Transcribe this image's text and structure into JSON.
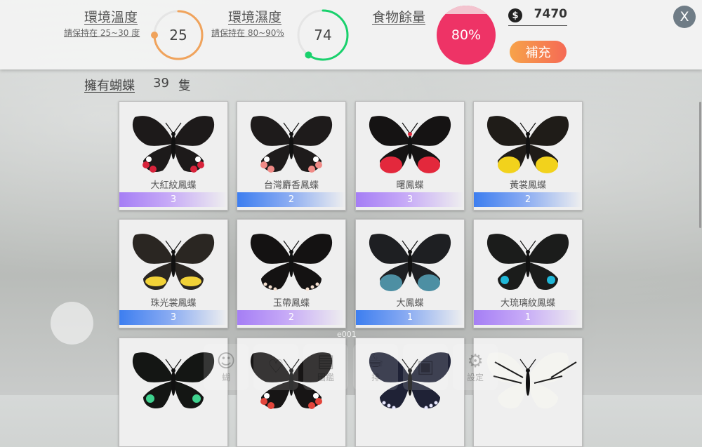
{
  "temperature": {
    "title": "環境溫度",
    "note": "請保持在 25~30 度",
    "value": "25",
    "level": 0.75,
    "color": "#f0a35c"
  },
  "humidity": {
    "title": "環境濕度",
    "note": "請保持在 80~90%",
    "value": "74",
    "level": 0.6,
    "color": "#18d16c"
  },
  "food": {
    "title": "食物餘量",
    "value": "80%",
    "color": "#ee3366"
  },
  "coins": {
    "symbol": "$",
    "amount": "7470"
  },
  "refill_label": "補充",
  "close_label": "X",
  "owned": {
    "label": "擁有蝴蝶",
    "count": "39",
    "unit": "隻"
  },
  "page_id": "e001",
  "butterflies": [
    {
      "name": "大紅紋鳳蝶",
      "count": "3",
      "bar": "purple",
      "icon": "red-spotted-swallowtail"
    },
    {
      "name": "台灣麝香鳳蝶",
      "count": "2",
      "bar": "blue",
      "icon": "pink-spotted-swallowtail"
    },
    {
      "name": "曙鳳蝶",
      "count": "3",
      "bar": "purple",
      "icon": "red-hindwing-swallowtail"
    },
    {
      "name": "黃裳鳳蝶",
      "count": "2",
      "bar": "blue",
      "icon": "yellow-birdwing"
    },
    {
      "name": "珠光裳鳳蝶",
      "count": "3",
      "bar": "blue",
      "icon": "golden-birdwing"
    },
    {
      "name": "玉帶鳳蝶",
      "count": "2",
      "bar": "purple",
      "icon": "white-banded-swallowtail"
    },
    {
      "name": "大鳳蝶",
      "count": "1",
      "bar": "blue",
      "icon": "blue-hindwing-swallowtail"
    },
    {
      "name": "大琉璃紋鳳蝶",
      "count": "1",
      "bar": "purple",
      "icon": "cyan-spotted-swallowtail"
    },
    {
      "name": "",
      "count": "",
      "bar": "none",
      "icon": "green-spotted-swallowtail"
    },
    {
      "name": "",
      "count": "",
      "bar": "none",
      "icon": "red-spot-swallowtail"
    },
    {
      "name": "",
      "count": "",
      "bar": "none",
      "icon": "purple-crow"
    },
    {
      "name": "",
      "count": "",
      "bar": "none",
      "icon": "paper-kite"
    }
  ],
  "nav": [
    {
      "label": "蝴",
      "icon": "person-icon"
    },
    {
      "label": "",
      "icon": "heart-icon"
    },
    {
      "label": "圖鑑",
      "icon": "book-icon"
    },
    {
      "label": "排",
      "icon": "cup-icon"
    },
    {
      "label": "",
      "icon": "bag-icon"
    },
    {
      "label": "設定",
      "icon": "gear-icon"
    }
  ]
}
